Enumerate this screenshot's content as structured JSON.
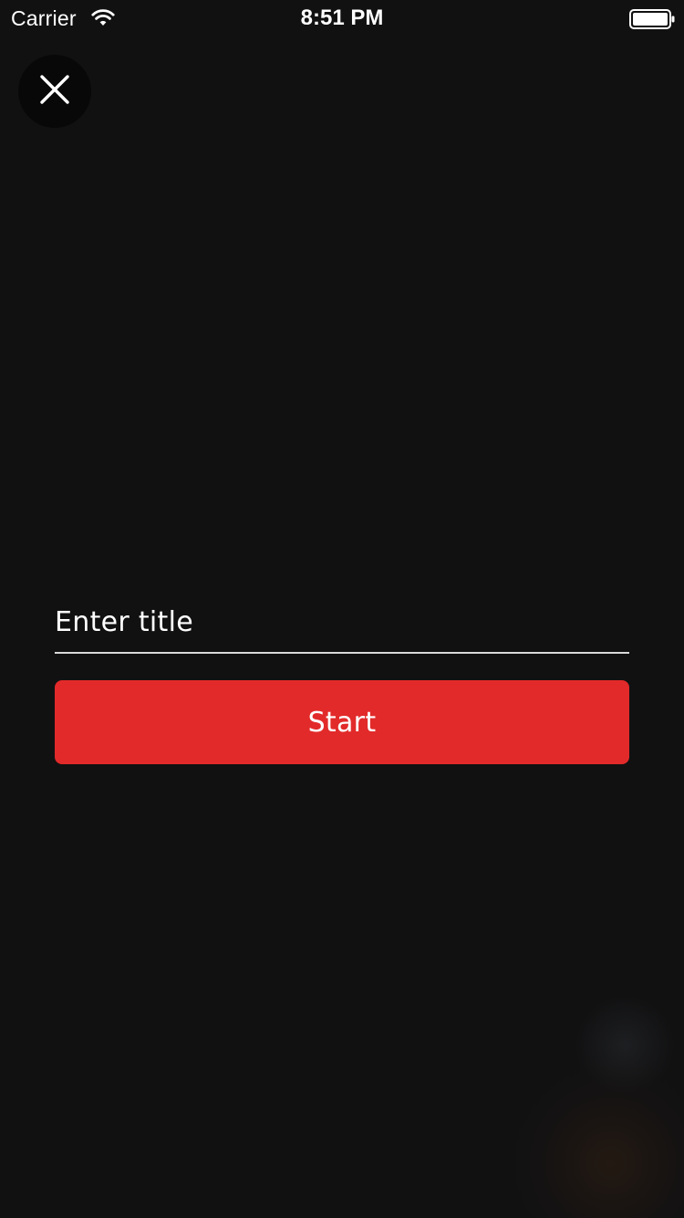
{
  "status_bar": {
    "carrier": "Carrier",
    "time": "8:51 PM",
    "wifi_icon": "wifi-icon",
    "battery_icon": "battery-icon"
  },
  "close_button": {
    "icon": "close-icon"
  },
  "form": {
    "title_input": {
      "value": "",
      "placeholder": "Enter title"
    },
    "start_button_label": "Start"
  },
  "colors": {
    "background": "#111112",
    "accent": "#e22a2a",
    "text": "#ffffff"
  }
}
